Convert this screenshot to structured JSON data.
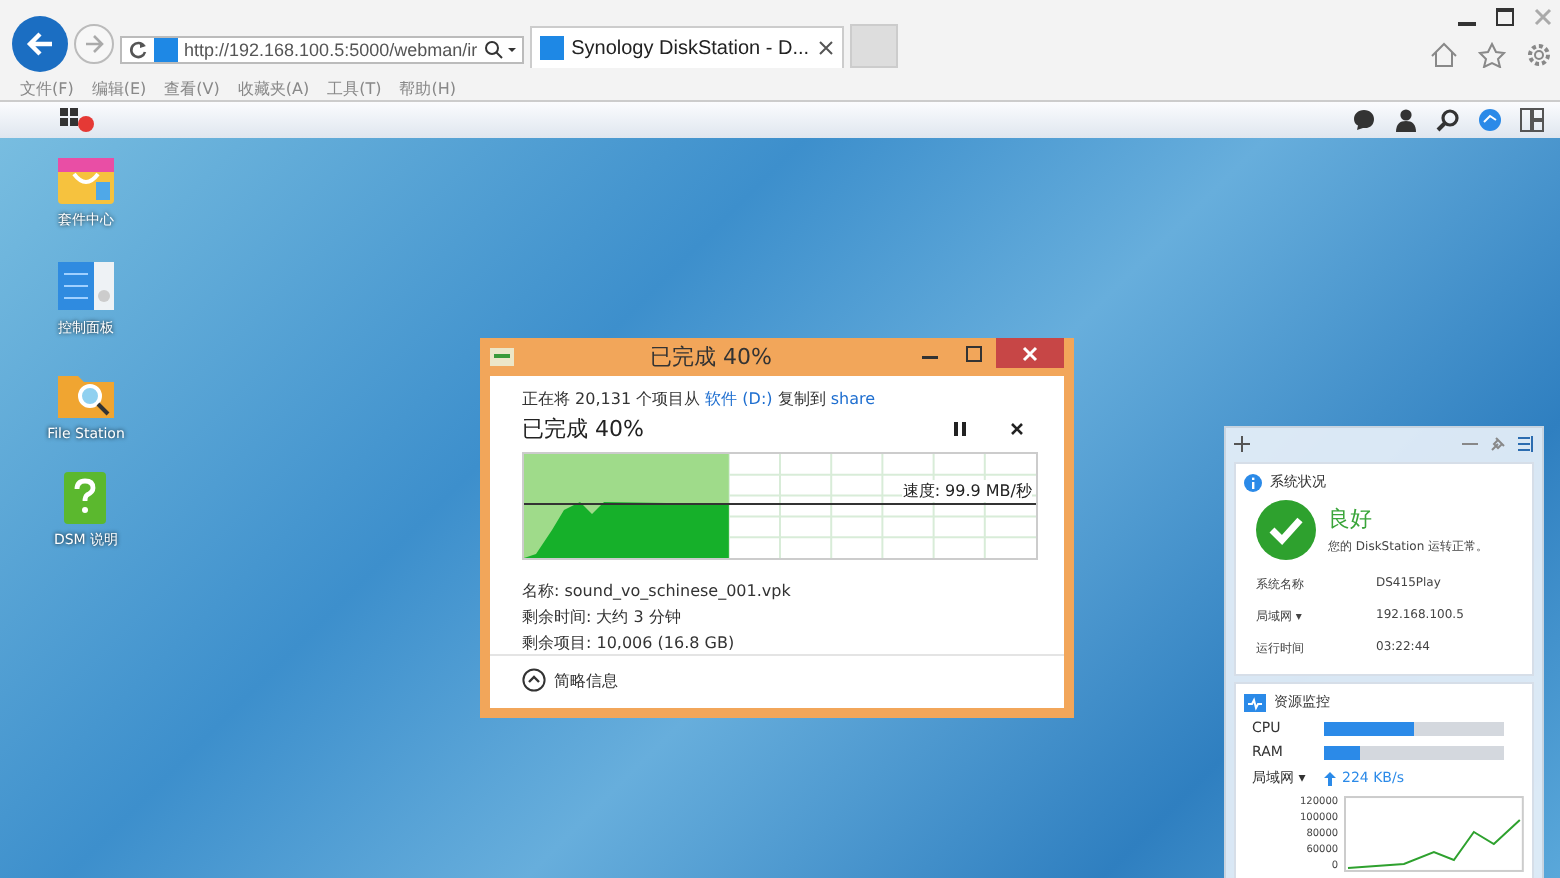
{
  "browser": {
    "address": "http://192.168.100.5:5000/webman/ir",
    "tab_title": "Synology DiskStation - D...",
    "menu": [
      "文件(F)",
      "编辑(E)",
      "查看(V)",
      "收藏夹(A)",
      "工具(T)",
      "帮助(H)"
    ]
  },
  "desktop_icons": [
    {
      "label": "套件中心",
      "kind": "package"
    },
    {
      "label": "控制面板",
      "kind": "panel"
    },
    {
      "label": "File Station",
      "kind": "folder"
    },
    {
      "label": "DSM 说明",
      "kind": "help"
    }
  ],
  "copy_dialog": {
    "title": "已完成 40%",
    "status_prefix": "正在将 20,131 个项目从",
    "source": "软件 (D:)",
    "status_middle": "复制到",
    "destination": "share",
    "heading": "已完成 40%",
    "level": 0.4,
    "speed": "速度: 99.9 MB/秒",
    "details": [
      "名称: sound_vo_schinese_001.vpk",
      "剩余时间: 大约 3 分钟",
      "剩余项目: 10,006 (16.8 GB)"
    ],
    "toggle": "简略信息"
  },
  "system_status": {
    "title": "系统状况",
    "state": "良好",
    "message": "您的 DiskStation 运转正常。",
    "rows": [
      {
        "label": "系统名称",
        "value": "DS415Play"
      },
      {
        "label": "局域网 ▾",
        "value": "192.168.100.5"
      },
      {
        "label": "运行时间",
        "value": "03:22:44"
      }
    ]
  },
  "resource_monitor": {
    "title": "资源监控",
    "meters": [
      {
        "label": "CPU",
        "level": 0.5
      },
      {
        "label": "RAM",
        "level": 0.2
      }
    ],
    "network_label": "局域网 ▾",
    "upload": "224 KB/s",
    "chart_ticks": [
      "120000",
      "100000",
      "80000",
      "60000",
      "0"
    ]
  }
}
